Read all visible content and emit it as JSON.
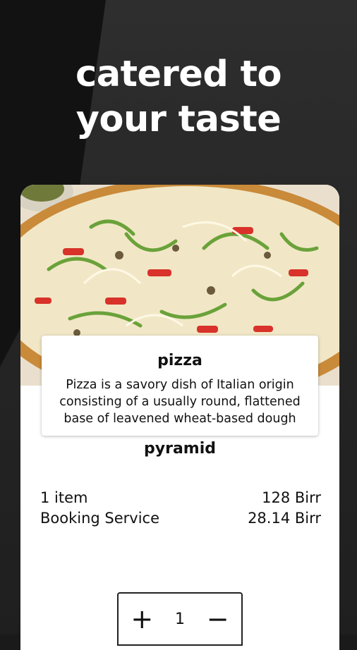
{
  "headline": {
    "line1": "catered to",
    "line2": "your taste"
  },
  "item": {
    "title": "pizza",
    "description": "Pizza is a savory dish of Italian origin consisting of a usually round, flattened base of leavened wheat-based dough"
  },
  "restaurant": "pyramid",
  "summary": {
    "items_label": "1 item",
    "items_price": "128 Birr",
    "service_label": "Booking Service",
    "service_price": "28.14 Birr"
  },
  "quantity": {
    "plus": "+",
    "value": "1",
    "minus": "−"
  }
}
